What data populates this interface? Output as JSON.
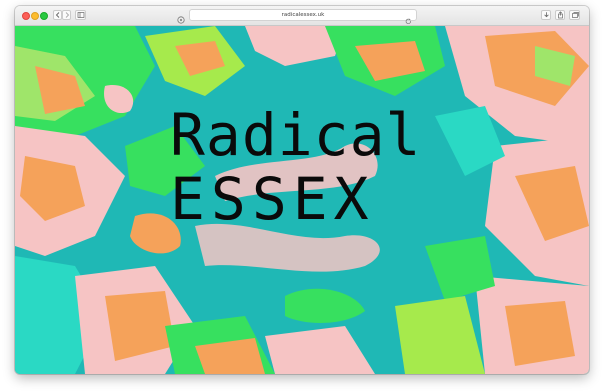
{
  "browser": {
    "url": "radicalessex.uk",
    "traffic_lights": [
      "close",
      "minimize",
      "maximize"
    ],
    "toolbar_icons": [
      "back-icon",
      "forward-icon",
      "sidebar-icon",
      "privacy-icon",
      "reload-icon",
      "download-icon",
      "share-icon",
      "tabs-icon"
    ]
  },
  "page": {
    "title_line1": "Radical",
    "title_line2": "ESSEX"
  },
  "colors": {
    "teal": "#1fb8b5",
    "green": "#37e05f",
    "orange": "#f5a25a",
    "pink": "#f6c4c4",
    "lime": "#a6ea4c",
    "text": "#0a0a0a"
  }
}
